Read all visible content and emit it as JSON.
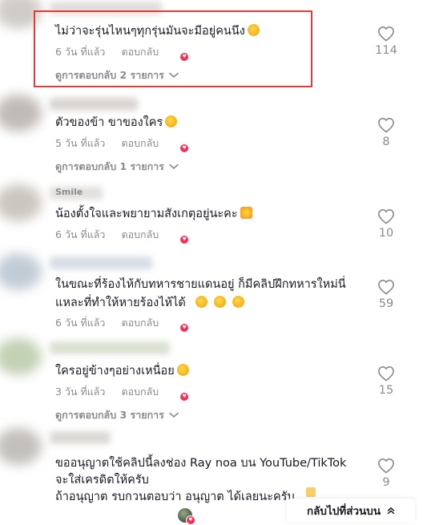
{
  "comments": [
    {
      "text": "ไม่ว่าจะรุ่นไหนๆทุกรุ่นมันจะมีอยู่คนนึง",
      "emojis": [
        "grinning-squinting-face"
      ],
      "time": "6 วัน ที่แล้ว",
      "reply_label": "ตอบกลับ",
      "view_replies": "ดูการตอบกลับ 2 รายการ",
      "likes": "114",
      "highlighted": true,
      "colors": {
        "avatar": "#c8c4be",
        "name": "#d6d3d0"
      }
    },
    {
      "text": "ตัวของข้า ขาของใคร",
      "emojis": [
        "smiling-face-with-sweat"
      ],
      "time": "5 วัน ที่แล้ว",
      "reply_label": "ตอบกลับ",
      "view_replies": "ดูการตอบกลับ 1 รายการ",
      "likes": "8",
      "colors": {
        "avatar": "#b7b0ab",
        "name": "#cbc6c3"
      }
    },
    {
      "author": "Smile",
      "text": "น้องตั้งใจและพยายามสังเกตุอยู่นะคะ",
      "emojis": [
        "smiling-face-with-hearts"
      ],
      "time": "6 วัน ที่แล้ว",
      "reply_label": "ตอบกลับ",
      "likes": "10",
      "colors": {
        "avatar": "#c3bdb5",
        "name": "#d8d4cf"
      }
    },
    {
      "text_line1": "ในขณะที่ร้องไห้กับทหารชายแดนอยู่ ก็มีคลิปฝึกทหารใหม่นี่",
      "text_line2": "แหละที่ทำให้หายร้องไห้ได้",
      "emojis": [
        "pleading-face",
        "smiling-face-with-sweat",
        "face-with-hand-over-mouth"
      ],
      "time": "6 วัน ที่แล้ว",
      "reply_label": "ตอบกลับ",
      "likes": "59",
      "colors": {
        "avatar": "#b8c4d0",
        "name": "#c9d3dd"
      }
    },
    {
      "text": "ใครอยู่ข้างๆอย่างเหนื่อย",
      "emojis": [
        "grinning-squinting-face"
      ],
      "time": "3 วัน ที่แล้ว",
      "reply_label": "ตอบกลับ",
      "view_replies": "ดูการตอบกลับ 3 รายการ",
      "likes": "15",
      "colors": {
        "avatar": "#b9c9a8",
        "name": "#cdd6c2"
      }
    },
    {
      "text_line1": "ขออนุญาตใช้คลิปนี้ลงช่อง Ray noa บน YouTube/TikTok",
      "text_line2": "จะใส่เครดิตให้ครับ",
      "text_line3": "ถ้าอนุญาต รบกวนตอบว่า อนุญาต ได้เลยนะครับ",
      "likes": "9",
      "colors": {
        "avatar": "#b9b6b2",
        "name": "#cfccc8"
      }
    }
  ],
  "back_to_top": "กลับไปที่ส่วนบน",
  "icons": {
    "like": "heart-outline-icon",
    "chevron": "chevron-down-icon",
    "back_to_top": "double-chevron-up-icon",
    "creator": "creator-avatar-heart-icon"
  },
  "colors": {
    "text": "#161823",
    "muted": "#8a8b91",
    "highlight_border": "#e53935",
    "creator_heart": "#fe2c55"
  }
}
